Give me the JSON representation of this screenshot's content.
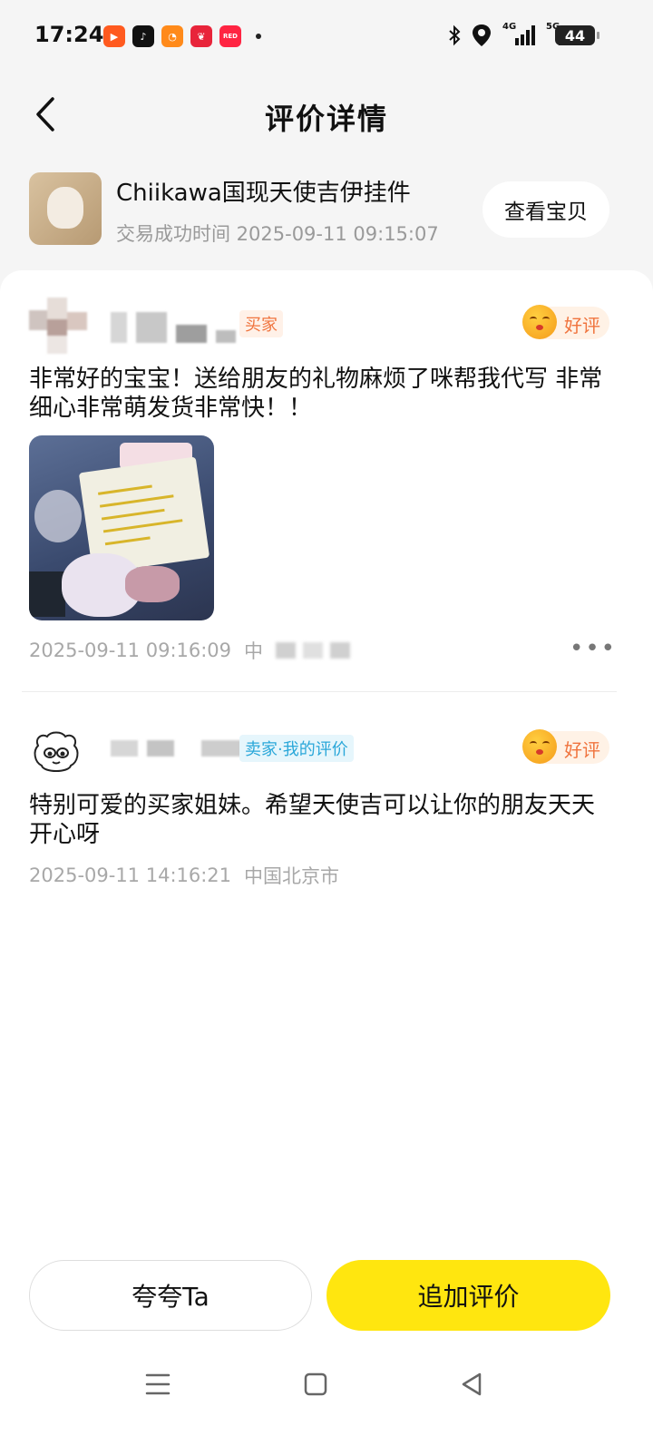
{
  "status_bar": {
    "time": "17:24",
    "battery": "44",
    "network_labels": [
      "4G",
      "5G"
    ],
    "notification_icons": [
      "video-app-icon",
      "tiktok-icon",
      "orange-app-icon",
      "red-app-icon",
      "xiaohongshu-icon"
    ]
  },
  "header": {
    "title": "评价详情"
  },
  "product": {
    "title": "Chiikawa国现天使吉伊挂件",
    "trade_time": "交易成功时间 2025-09-11 09:15:07",
    "view_button": "查看宝贝"
  },
  "reviews": [
    {
      "role_tag": "买家",
      "rating": "好评",
      "text": "非常好的宝宝！送给朋友的礼物麻烦了咪帮我代写 非常细心非常萌发货非常快！！",
      "timestamp": "2025-09-11 09:16:09",
      "location": "中",
      "has_photo": true
    },
    {
      "role_tag": "卖家·我的评价",
      "rating": "好评",
      "text": "特别可爱的买家姐妹。希望天使吉可以让你的朋友天天开心呀",
      "timestamp": "2025-09-11 14:16:21",
      "location": "中国北京市",
      "has_photo": false
    }
  ],
  "more_label": "•••",
  "bottom": {
    "praise_button": "夸夸Ta",
    "add_review_button": "追加评价"
  },
  "colors": {
    "accent_yellow": "#ffe60f",
    "rating_orange": "#f0743e",
    "seller_tag_blue": "#2aa7d9",
    "page_bg": "#f5f5f5"
  }
}
